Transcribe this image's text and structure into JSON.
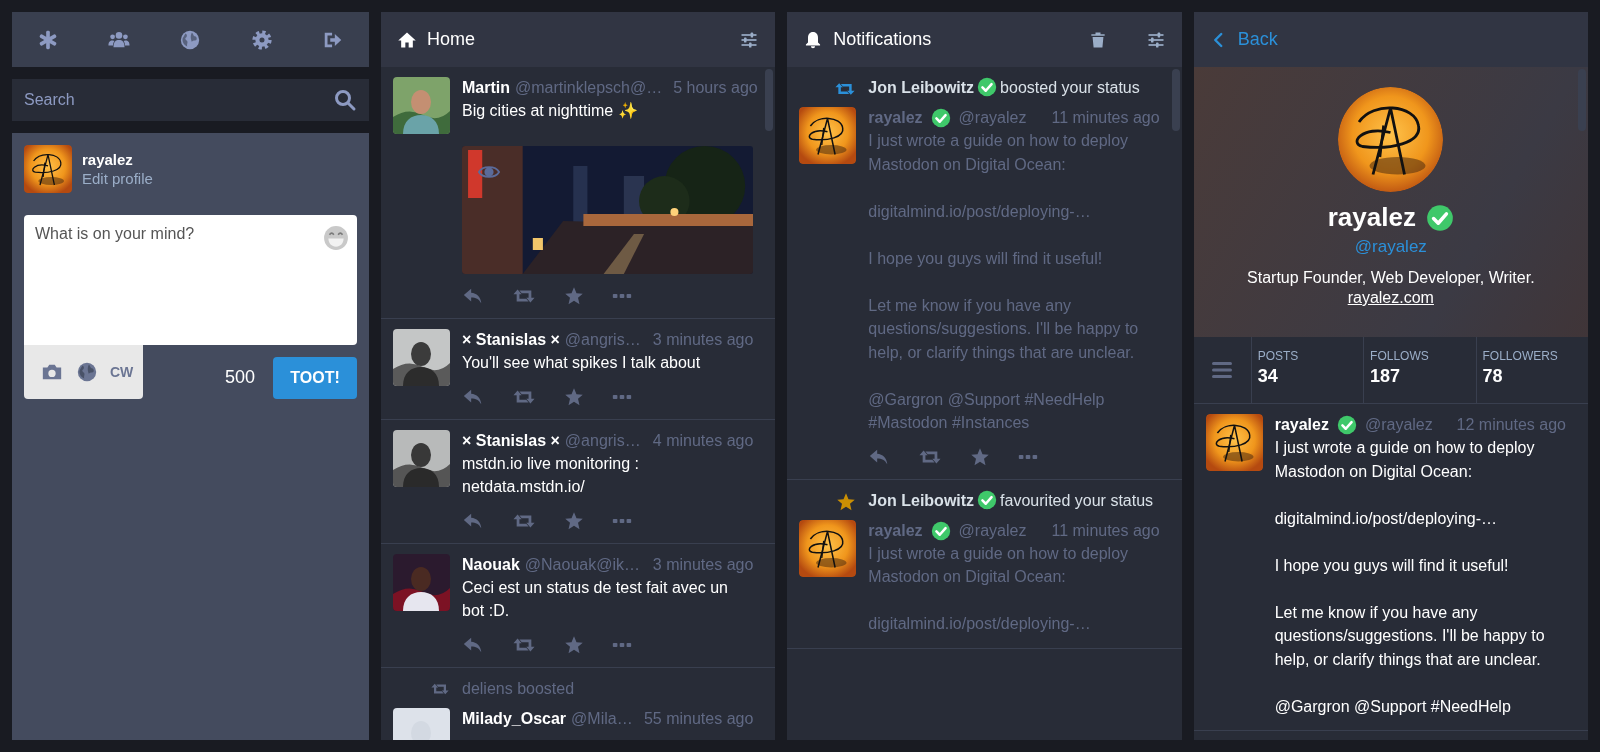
{
  "search": {
    "placeholder": "Search"
  },
  "compose": {
    "name": "rayalez",
    "edit_profile": "Edit profile",
    "placeholder": "What is on your mind?",
    "cw": "CW",
    "counter": "500",
    "submit": "TOOT!"
  },
  "home": {
    "title": "Home",
    "statuses": [
      {
        "avatar": {
          "kind": "picture"
        },
        "name": "Martin",
        "handle": "@martinklepsch@…",
        "time": "5 hours ago",
        "paragraphs": [
          "Big cities at nighttime ✨"
        ],
        "media": {
          "kind": "picture"
        },
        "actions": true
      },
      {
        "avatar": {
          "kind": "picture"
        },
        "name": "× Stanislas ×",
        "handle": "@angris…",
        "time": "3 minutes ago",
        "paragraphs": [
          "You'll see what spikes I talk about"
        ],
        "actions": true
      },
      {
        "avatar": {
          "kind": "picture"
        },
        "name": "× Stanislas ×",
        "handle": "@angris…",
        "time": "4 minutes ago",
        "paragraphs": [
          "mstdn.io live monitoring : netdata.mstdn.io/"
        ],
        "actions": true
      },
      {
        "avatar": {
          "kind": "picture"
        },
        "name": "Naouak",
        "handle": "@Naouak@ik…",
        "time": "3 minutes ago",
        "paragraphs": [
          "Ceci est un status de test fait avec un bot :D."
        ],
        "actions": true
      },
      {
        "reblog": "deliens boosted",
        "avatar": {
          "kind": "picture"
        },
        "name": "Milady_Oscar",
        "handle": "@Mila…",
        "time": "55 minutes ago"
      }
    ]
  },
  "notifications": {
    "title": "Notifications",
    "items": [
      {
        "kind": "boost",
        "actor": "Jon Leibowitz",
        "verified": true,
        "action": "boosted your status",
        "status": {
          "avatar": {
            "kind": "logo"
          },
          "name": "rayalez",
          "verified": true,
          "handle": "@rayalez",
          "time": "11 minutes ago",
          "dimmed": true,
          "paragraphs": [
            "I just wrote a guide on how to deploy Mastodon on Digital Ocean:",
            "digitalmind.io/post/deploying-…",
            "I hope you guys will find it useful!",
            "Let me know if you have any questions/suggestions. I'll be happy to help, or clarify things that are unclear.",
            "@Gargron @Support  #NeedHelp #Mastodon #Instances"
          ],
          "actions": true
        }
      },
      {
        "kind": "favourite",
        "actor": "Jon Leibowitz",
        "verified": true,
        "action": "favourited your status",
        "status": {
          "avatar": {
            "kind": "logo"
          },
          "name": "rayalez",
          "verified": true,
          "handle": "@rayalez",
          "time": "11 minutes ago",
          "dimmed": true,
          "paragraphs": [
            "I just wrote a guide on how to deploy Mastodon on Digital Ocean:",
            "digitalmind.io/post/deploying-…"
          ]
        }
      }
    ]
  },
  "profile": {
    "back": "Back",
    "name": "rayalez",
    "verified": true,
    "handle": "@rayalez",
    "bio": "Startup Founder, Web Developer, Writer.",
    "link": "rayalez.com",
    "stats": [
      {
        "label": "POSTS",
        "value": "34"
      },
      {
        "label": "FOLLOWS",
        "value": "187"
      },
      {
        "label": "FOLLOWERS",
        "value": "78"
      }
    ],
    "statuses": [
      {
        "avatar": {
          "kind": "logo"
        },
        "name": "rayalez",
        "verified": true,
        "handle": "@rayalez",
        "time": "12 minutes ago",
        "dimmed": false,
        "paragraphs": [
          "I just wrote a guide on how to deploy Mastodon on Digital Ocean:",
          "digitalmind.io/post/deploying-…",
          "I hope you guys will find it useful!",
          "Let me know if you have any questions/suggestions. I'll be happy to help, or clarify things that are unclear.",
          "@Gargron @Support  #NeedHelp"
        ]
      }
    ]
  }
}
